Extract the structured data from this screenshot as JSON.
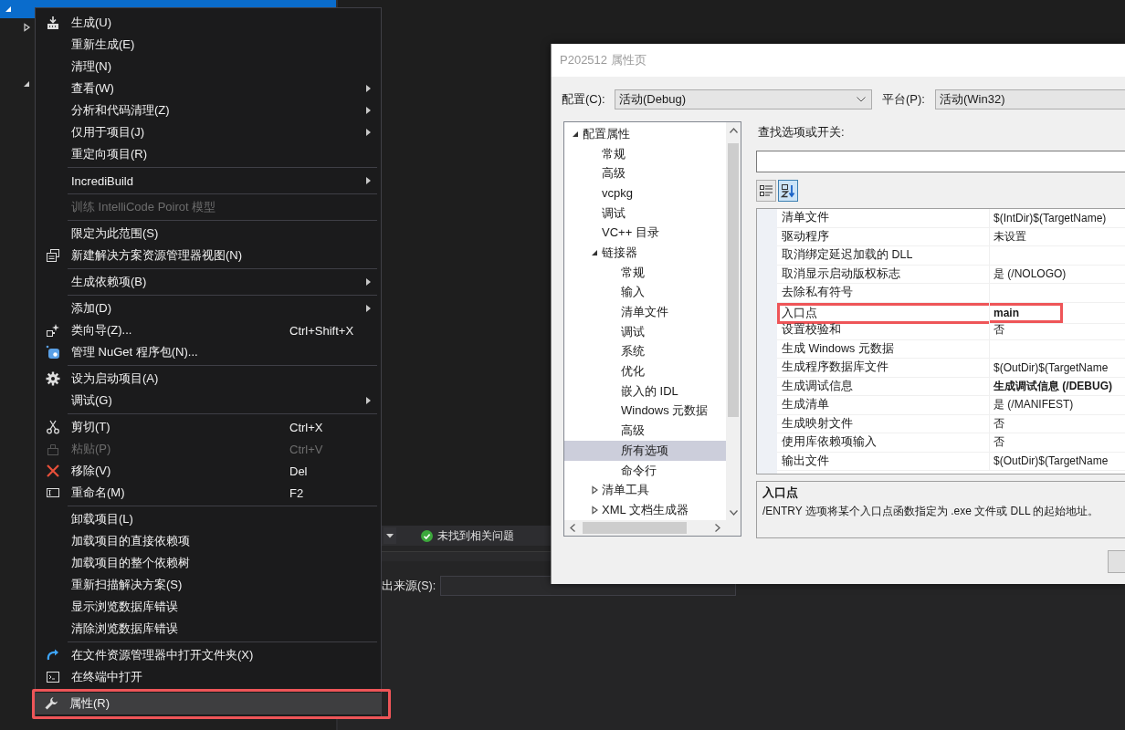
{
  "solution_explorer": {
    "nodes": [
      {
        "expanded": true,
        "selected": true,
        "children": [
          {
            "expanded": false,
            "selected": false
          },
          {
            "expanded": true,
            "selected": false
          }
        ]
      }
    ]
  },
  "output_panel": {
    "status": "未找到相关问题",
    "source_label": "出来源(S):"
  },
  "context_menu": {
    "items": [
      {
        "kind": "item",
        "label": "生成(U)",
        "submenu": false,
        "disabled": false,
        "highlighted": false,
        "annotated": false
      },
      {
        "kind": "item",
        "label": "重新生成(E)",
        "submenu": false,
        "disabled": false,
        "highlighted": false,
        "annotated": false
      },
      {
        "kind": "item",
        "label": "清理(N)",
        "submenu": false,
        "disabled": false,
        "highlighted": false,
        "annotated": false
      },
      {
        "kind": "item",
        "label": "查看(W)",
        "submenu": true,
        "disabled": false,
        "highlighted": false,
        "annotated": false
      },
      {
        "kind": "item",
        "label": "分析和代码清理(Z)",
        "submenu": true,
        "disabled": false,
        "highlighted": false,
        "annotated": false
      },
      {
        "kind": "item",
        "label": "仅用于项目(J)",
        "submenu": true,
        "disabled": false,
        "highlighted": false,
        "annotated": false
      },
      {
        "kind": "item",
        "label": "重定向项目(R)",
        "submenu": false,
        "disabled": false,
        "highlighted": false,
        "annotated": false
      },
      {
        "kind": "separator"
      },
      {
        "kind": "item",
        "label": "IncrediBuild",
        "submenu": true,
        "disabled": false,
        "highlighted": false,
        "annotated": false
      },
      {
        "kind": "separator"
      },
      {
        "kind": "item",
        "label": "训练 IntelliCode Poirot 模型",
        "submenu": false,
        "disabled": true,
        "highlighted": false,
        "annotated": false
      },
      {
        "kind": "separator"
      },
      {
        "kind": "item",
        "label": "限定为此范围(S)",
        "submenu": false,
        "disabled": false,
        "highlighted": false,
        "annotated": false
      },
      {
        "kind": "item",
        "label": "新建解决方案资源管理器视图(N)",
        "submenu": false,
        "disabled": false,
        "highlighted": false,
        "annotated": false
      },
      {
        "kind": "separator"
      },
      {
        "kind": "item",
        "label": "生成依赖项(B)",
        "submenu": true,
        "disabled": false,
        "highlighted": false,
        "annotated": false
      },
      {
        "kind": "separator"
      },
      {
        "kind": "item",
        "label": "添加(D)",
        "submenu": true,
        "disabled": false,
        "highlighted": false,
        "annotated": false
      },
      {
        "kind": "item",
        "label": "类向导(Z)...",
        "shortcut": "Ctrl+Shift+X",
        "submenu": false,
        "disabled": false,
        "highlighted": false,
        "annotated": false
      },
      {
        "kind": "item",
        "label": "管理 NuGet 程序包(N)...",
        "submenu": false,
        "disabled": false,
        "highlighted": false,
        "annotated": false
      },
      {
        "kind": "separator"
      },
      {
        "kind": "item",
        "label": "设为启动项目(A)",
        "submenu": false,
        "disabled": false,
        "highlighted": false,
        "annotated": false
      },
      {
        "kind": "item",
        "label": "调试(G)",
        "submenu": true,
        "disabled": false,
        "highlighted": false,
        "annotated": false
      },
      {
        "kind": "separator"
      },
      {
        "kind": "item",
        "label": "剪切(T)",
        "shortcut": "Ctrl+X",
        "submenu": false,
        "disabled": false,
        "highlighted": false,
        "annotated": false
      },
      {
        "kind": "item",
        "label": "粘贴(P)",
        "shortcut": "Ctrl+V",
        "submenu": false,
        "disabled": true,
        "highlighted": false,
        "annotated": false
      },
      {
        "kind": "item",
        "label": "移除(V)",
        "shortcut": "Del",
        "submenu": false,
        "disabled": false,
        "highlighted": false,
        "annotated": false
      },
      {
        "kind": "item",
        "label": "重命名(M)",
        "shortcut": "F2",
        "submenu": false,
        "disabled": false,
        "highlighted": false,
        "annotated": false
      },
      {
        "kind": "separator"
      },
      {
        "kind": "item",
        "label": "卸载项目(L)",
        "submenu": false,
        "disabled": false,
        "highlighted": false,
        "annotated": false
      },
      {
        "kind": "item",
        "label": "加载项目的直接依赖项",
        "submenu": false,
        "disabled": false,
        "highlighted": false,
        "annotated": false
      },
      {
        "kind": "item",
        "label": "加载项目的整个依赖树",
        "submenu": false,
        "disabled": false,
        "highlighted": false,
        "annotated": false
      },
      {
        "kind": "item",
        "label": "重新扫描解决方案(S)",
        "submenu": false,
        "disabled": false,
        "highlighted": false,
        "annotated": false
      },
      {
        "kind": "item",
        "label": "显示浏览数据库错误",
        "submenu": false,
        "disabled": false,
        "highlighted": false,
        "annotated": false
      },
      {
        "kind": "item",
        "label": "清除浏览数据库错误",
        "submenu": false,
        "disabled": false,
        "highlighted": false,
        "annotated": false
      },
      {
        "kind": "separator"
      },
      {
        "kind": "item",
        "label": "在文件资源管理器中打开文件夹(X)",
        "submenu": false,
        "disabled": false,
        "highlighted": false,
        "annotated": false
      },
      {
        "kind": "item",
        "label": "在终端中打开",
        "submenu": false,
        "disabled": false,
        "highlighted": false,
        "annotated": false
      },
      {
        "kind": "separator"
      },
      {
        "kind": "item",
        "label": "属性(R)",
        "submenu": false,
        "disabled": false,
        "highlighted": true,
        "annotated": true
      }
    ]
  },
  "dialog": {
    "title": "P202512 属性页",
    "configuration_label": "配置(C):",
    "configuration": "活动(Debug)",
    "platform_label": "平台(P):",
    "platform": "活动(Win32)",
    "tree": [
      {
        "label": "配置属性",
        "expanded": true,
        "selected": false,
        "children": [
          {
            "label": "常规",
            "selected": false
          },
          {
            "label": "高级",
            "selected": false
          },
          {
            "label": "vcpkg",
            "selected": false
          },
          {
            "label": "调试",
            "selected": false
          },
          {
            "label": "VC++ 目录",
            "selected": false
          },
          {
            "label": "链接器",
            "expanded": true,
            "selected": false,
            "children": [
              {
                "label": "常规",
                "selected": false
              },
              {
                "label": "输入",
                "selected": false
              },
              {
                "label": "清单文件",
                "selected": false
              },
              {
                "label": "调试",
                "selected": false
              },
              {
                "label": "系统",
                "selected": false
              },
              {
                "label": "优化",
                "selected": false
              },
              {
                "label": "嵌入的 IDL",
                "selected": false
              },
              {
                "label": "Windows 元数据",
                "selected": false
              },
              {
                "label": "高级",
                "selected": false
              },
              {
                "label": "所有选项",
                "selected": true
              },
              {
                "label": "命令行",
                "selected": false
              }
            ]
          },
          {
            "label": "清单工具",
            "expanded": false,
            "selected": false
          },
          {
            "label": "XML 文档生成器",
            "expanded": false,
            "selected": false
          }
        ]
      }
    ],
    "search_label": "查找选项或开关:",
    "view_buttons": [
      {
        "kind": "categorized",
        "selected": false
      },
      {
        "kind": "alphabetical",
        "selected": true
      }
    ],
    "properties": [
      {
        "name": "清单文件",
        "value": "$(IntDir)$(TargetName)",
        "bold": false,
        "annotated": false
      },
      {
        "name": "驱动程序",
        "value": "未设置",
        "bold": false,
        "annotated": false
      },
      {
        "name": "取消绑定延迟加载的 DLL",
        "annotated": false
      },
      {
        "name": "取消显示启动版权标志",
        "value": "是 (/NOLOGO)",
        "bold": false,
        "annotated": false
      },
      {
        "name": "去除私有符号",
        "annotated": false
      },
      {
        "name": "入口点",
        "value": "main",
        "bold": true,
        "annotated": true
      },
      {
        "name": "设置校验和",
        "value": "否",
        "bold": false,
        "annotated": false
      },
      {
        "name": "生成 Windows 元数据",
        "annotated": false
      },
      {
        "name": "生成程序数据库文件",
        "value": "$(OutDir)$(TargetName",
        "bold": false,
        "annotated": false
      },
      {
        "name": "生成调试信息",
        "value": "生成调试信息 (/DEBUG)",
        "bold": true,
        "annotated": false
      },
      {
        "name": "生成清单",
        "value": "是 (/MANIFEST)",
        "bold": false,
        "annotated": false
      },
      {
        "name": "生成映射文件",
        "value": "否",
        "bold": false,
        "annotated": false
      },
      {
        "name": "使用库依赖项输入",
        "value": "否",
        "bold": false,
        "annotated": false
      },
      {
        "name": "输出文件",
        "value": "$(OutDir)$(TargetName",
        "bold": false,
        "annotated": false
      }
    ],
    "description": {
      "title": "入口点",
      "text": "/ENTRY 选项将某个入口点函数指定为 .exe 文件或 DLL 的起始地址。"
    }
  }
}
